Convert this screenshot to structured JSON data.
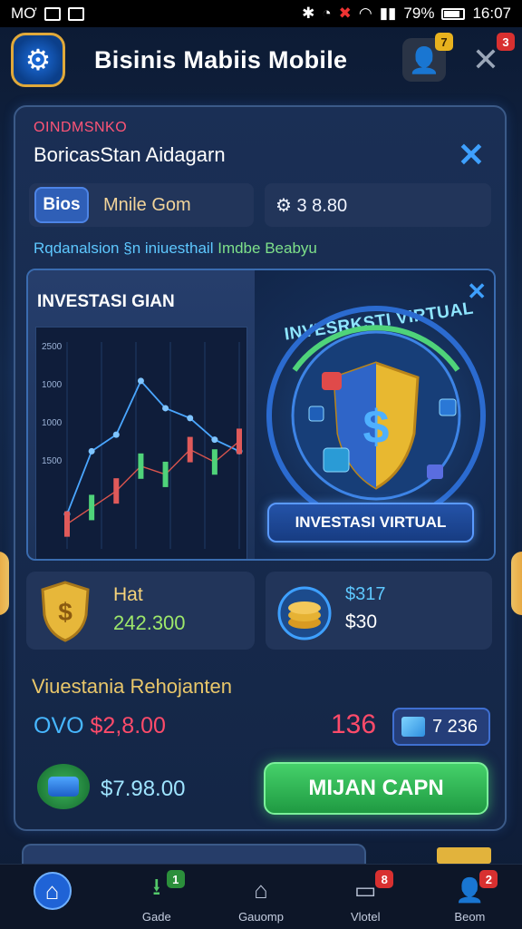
{
  "status_bar": {
    "left_text": "MƠ",
    "battery": "79%",
    "time": "16:07"
  },
  "header": {
    "title": "Bisinis Mabiis Mobile",
    "user_badge": "7",
    "close_badge": "3"
  },
  "panel": {
    "tag": "OINDMSNKO",
    "subtitle": "BoricasStan Aidagarn",
    "chip_label": "Bios",
    "field_a_text": "Mnile Gom",
    "field_b_text": "⚙ 3 8.80",
    "info_text": "Rqdanalsion §n iniuesthail",
    "info_highlight": "Imdbe Beabyu"
  },
  "showcase": {
    "chart_title": "INVESTASI GIAN",
    "virtual_arc_label": "INVESRKSTI VIRTUAL",
    "virtual_button": "INVESTASI VIRTUAL"
  },
  "chart_data": {
    "type": "line",
    "title": "",
    "yticks": [
      "2500",
      "1000",
      "1000",
      "1500"
    ],
    "series": [
      {
        "values": [
          420,
          1180,
          1380,
          2030,
          1700,
          1580,
          1320,
          1180
        ]
      },
      {
        "values": [
          300,
          500,
          700,
          1000,
          900,
          1200,
          1050,
          1300
        ]
      }
    ]
  },
  "stats": {
    "a_label": "Hat",
    "a_value": "242.300",
    "b_label": "$317",
    "b_value": "$30"
  },
  "summary": {
    "section_title": "Viuestania Rehojanten",
    "left_prefix": "OVO",
    "left_amount": "$2,8.00",
    "mid_value": "136",
    "chip_value": "7 236",
    "pay_amount": "$7.98.00",
    "cta_label": "MIJAN CAPN"
  },
  "nav": {
    "items": [
      {
        "label": "",
        "badge": ""
      },
      {
        "label": "Gade",
        "badge": "1"
      },
      {
        "label": "Gauomp",
        "badge": ""
      },
      {
        "label": "Vlotel",
        "badge": "8"
      },
      {
        "label": "Beom",
        "badge": "2"
      }
    ]
  },
  "colors": {
    "accent": "#3ea0ff",
    "cta": "#2fb552",
    "warning": "#e9c76a",
    "danger": "#ff4b6a"
  }
}
